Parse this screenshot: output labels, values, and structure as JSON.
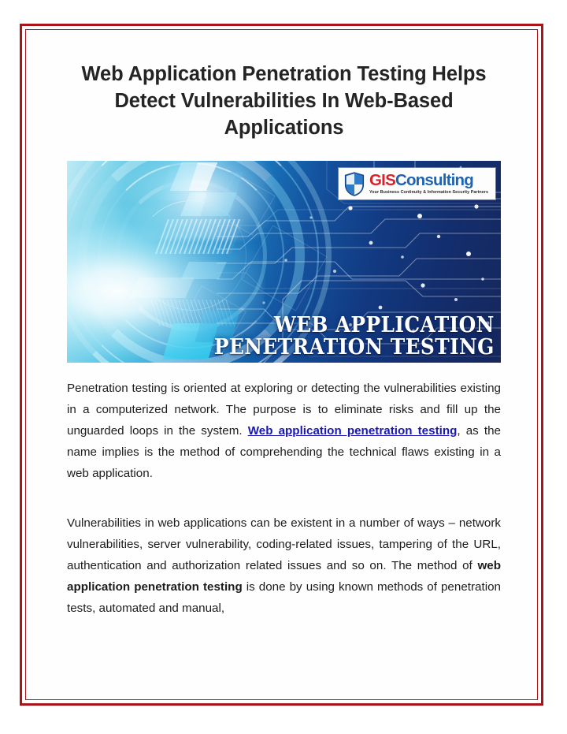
{
  "page": {
    "border_color": "#a81418",
    "background": "#ffffff"
  },
  "title": "Web Application Penetration Testing Helps Detect Vulnerabilities In Web-Based Applications",
  "banner": {
    "logo": {
      "name_part_1": "GIS",
      "name_part_2": "Consulting",
      "tagline": "Your Business Continuity & Information Security Partners",
      "brand_red": "#d8232a",
      "brand_blue": "#1f63b4",
      "shield_icon": "shield-icon"
    },
    "heading_line_1": "WEB APPLICATION",
    "heading_line_2": "PENETRATION TESTING"
  },
  "body": {
    "paragraph_1": {
      "text_before_link": "Penetration testing is oriented at exploring or detecting the vulnerabilities existing in a computerized network. The purpose is to eliminate risks and fill up the unguarded loops in the system. ",
      "link_text": "Web application penetration testing",
      "text_after_link": ", as the name implies is the method of comprehending the technical flaws existing in a web application.",
      "link_color": "#1a18b5"
    },
    "paragraph_2": {
      "text_before_bold": "Vulnerabilities in web applications can be existent in a number of ways – network vulnerabilities, server vulnerability, coding-related issues, tampering of the URL, authentication and authorization related issues and so on. The method of ",
      "bold_text": "web application penetration testing",
      "text_after_bold": " is done by using known methods of penetration tests, automated and manual,"
    }
  }
}
